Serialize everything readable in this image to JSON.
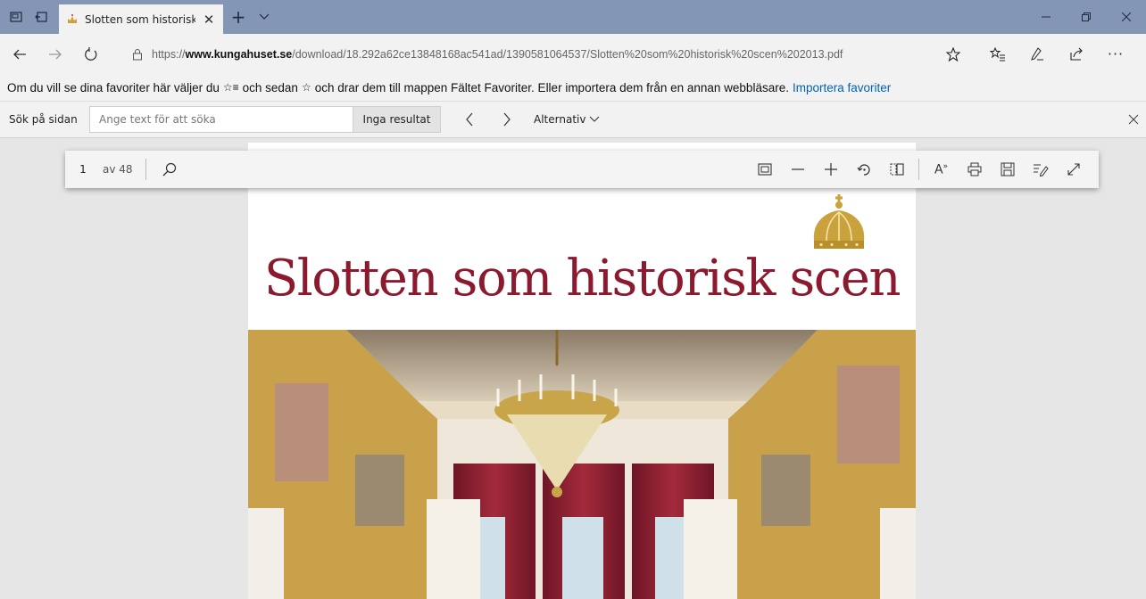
{
  "tab": {
    "title": "Slotten som historisk sc"
  },
  "address": {
    "scheme": "https://",
    "host": "www.kungahuset.se",
    "path": "/download/18.292a62ce13848168ac541ad/1390581064537/Slotten%20som%20historisk%20scen%202013.pdf"
  },
  "favorites_hint": {
    "text_before": "Om du vill se dina favoriter här väljer du",
    "text_middle": "och sedan",
    "text_after": "och drar dem till mappen Fältet Favoriter. Eller importera dem från en annan webbläsare.",
    "link": "Importera favoriter"
  },
  "find": {
    "label": "Sök på sidan",
    "placeholder": "Ange text för att söka",
    "result": "Inga resultat",
    "options_label": "Alternativ"
  },
  "pdf_toolbar": {
    "page_number": "1",
    "page_total": "av 48",
    "read_aloud_label": "A"
  },
  "document": {
    "title": "Slotten som historisk scen"
  },
  "colors": {
    "titlebar": "#8496b6",
    "chrome": "#f2f2f2",
    "link": "#0063b1",
    "doc_title": "#8b1a2e",
    "crown_gold": "#c9a23c"
  },
  "icons": {
    "tab_aside": "tab-aside-icon",
    "back_tabs": "set-aside-icon",
    "favicon": "crown-icon",
    "star": "star-icon",
    "favorites": "favorites-icon",
    "notes": "pen-icon",
    "share": "share-icon",
    "more": "more-icon"
  }
}
